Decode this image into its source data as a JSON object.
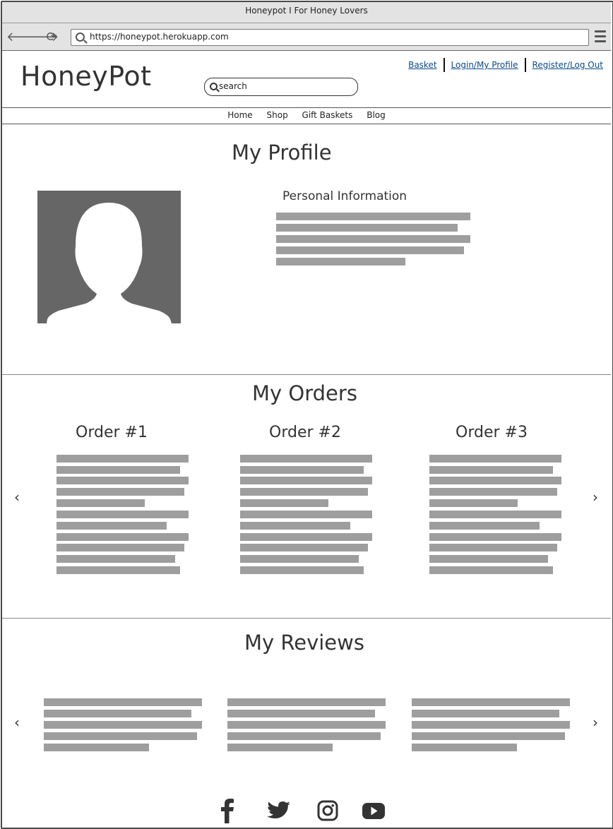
{
  "browser": {
    "title": "Honeypot I For Honey Lovers",
    "url": "https://honeypot.herokuapp.com",
    "back_glyph": "🡐",
    "forward_glyph": "🡒",
    "reload_glyph": "⟳"
  },
  "header": {
    "logo": "HoneyPot",
    "search_placeholder": "search",
    "links": {
      "basket": "Basket",
      "login": "Login/My Profile",
      "register": "Register/Log Out"
    }
  },
  "nav": {
    "items": [
      "Home",
      "Shop",
      "Gift Baskets",
      "Blog"
    ]
  },
  "profile": {
    "title": "My Profile",
    "personal_info_heading": "Personal Information"
  },
  "orders": {
    "title": "My Orders",
    "items": [
      {
        "label": "Order #1"
      },
      {
        "label": "Order #2"
      },
      {
        "label": "Order #3"
      }
    ],
    "prev_glyph": "‹",
    "next_glyph": "›"
  },
  "reviews": {
    "title": "My Reviews",
    "prev_glyph": "‹",
    "next_glyph": "›"
  },
  "footer": {
    "social_icons": [
      "facebook-icon",
      "twitter-icon",
      "instagram-icon",
      "youtube-icon"
    ]
  }
}
